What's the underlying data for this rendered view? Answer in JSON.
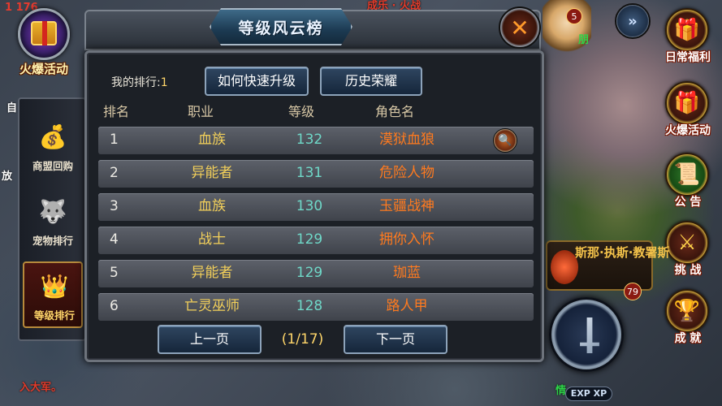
{
  "status": {
    "network": "1 176"
  },
  "event_button": {
    "label": "火爆活动"
  },
  "world_texts": {
    "top_red": "成乐 · 火战",
    "left_edge": "自",
    "left_edge2": "放",
    "bottom_left": "入大军。",
    "bottom_green": "情"
  },
  "hero": {
    "level": "5",
    "name": "朋"
  },
  "right_menu": [
    {
      "label": "日常福利",
      "icon": "gift-icon",
      "glyph": "🎁"
    },
    {
      "label": "火爆活动",
      "icon": "gift-icon",
      "glyph": "🎁"
    },
    {
      "label": "公 告",
      "icon": "notice-icon",
      "glyph": "📜"
    },
    {
      "label": "挑 战",
      "icon": "crossed-swords-icon",
      "glyph": "⚔"
    },
    {
      "label": "成 就",
      "icon": "trophy-icon",
      "glyph": "🏆"
    }
  ],
  "chat": {
    "text": "斯那·执斯·教署斯"
  },
  "skill": {
    "level": "79",
    "exp_label": "EXP XP"
  },
  "left_tabs": [
    {
      "label": "商盟回购",
      "icon": "coins-icon",
      "glyph": "💰",
      "active": false
    },
    {
      "label": "宠物排行",
      "icon": "pet-icon",
      "glyph": "🐺",
      "active": false
    },
    {
      "label": "等级排行",
      "icon": "crown-icon",
      "glyph": "👑",
      "active": true
    }
  ],
  "panel": {
    "title": "等级风云榜",
    "my_rank_label": "我的排行:",
    "my_rank_value": "1",
    "howto_label": "如何快速升级",
    "honor_label": "历史荣耀",
    "columns": {
      "rank": "排名",
      "class": "职业",
      "level": "等级",
      "name": "角色名"
    },
    "rows": [
      {
        "rank": "1",
        "class": "血族",
        "level": "132",
        "name": "漠狱血狼"
      },
      {
        "rank": "2",
        "class": "异能者",
        "level": "131",
        "name": "危险人物"
      },
      {
        "rank": "3",
        "class": "血族",
        "level": "130",
        "name": "玉疆战神"
      },
      {
        "rank": "4",
        "class": "战士",
        "level": "129",
        "name": "拥你入怀"
      },
      {
        "rank": "5",
        "class": "异能者",
        "level": "129",
        "name": "珈蓝"
      },
      {
        "rank": "6",
        "class": "亡灵巫师",
        "level": "128",
        "name": "路人甲"
      }
    ],
    "prev_label": "上一页",
    "next_label": "下一页",
    "pager": "(1/17)",
    "close_glyph": "✕",
    "inspect_glyph": "🔍"
  }
}
